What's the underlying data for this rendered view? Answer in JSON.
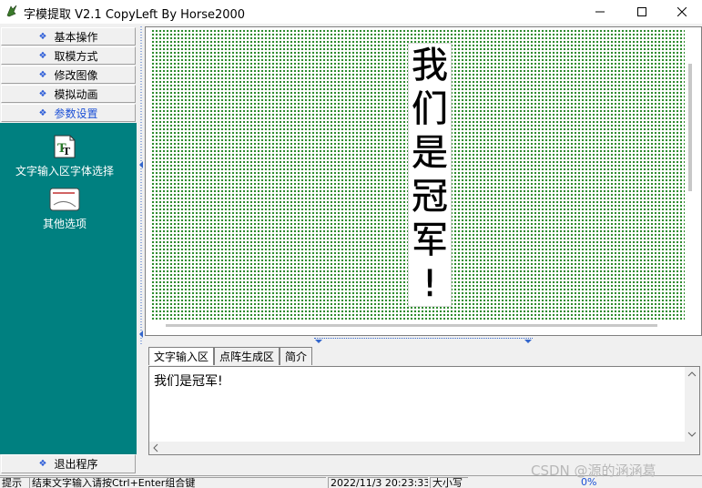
{
  "window": {
    "title": "字模提取 V2.1  CopyLeft By Horse2000",
    "minimize_glyph": "—",
    "maximize_glyph": "☐",
    "close_glyph": "✕"
  },
  "sidebar": {
    "items": [
      {
        "label": "基本操作"
      },
      {
        "label": "取模方式"
      },
      {
        "label": "修改图像"
      },
      {
        "label": "模拟动画"
      },
      {
        "label": "参数设置"
      }
    ],
    "bullet": "❖",
    "panel": [
      {
        "label": "文字输入区字体选择",
        "icon": "font-tt-icon"
      },
      {
        "label": "其他选项",
        "icon": "options-icon"
      }
    ],
    "exit_label": "退出程序"
  },
  "canvas": {
    "glyphs": [
      "我",
      "们",
      "是",
      "冠",
      "军",
      "!"
    ]
  },
  "tabs": [
    {
      "label": "文字输入区"
    },
    {
      "label": "点阵生成区"
    },
    {
      "label": "简介"
    }
  ],
  "editor": {
    "text": "我们是冠军!"
  },
  "statusbar": {
    "hint": "提示",
    "message": "结束文字输入请按Ctrl+Enter组合键",
    "datetime": "2022/11/3 20:23:33",
    "caps": "大小写",
    "progress": "0%"
  },
  "watermark": "CSDN @源的涵涵葛",
  "colors": {
    "sidebar_panel": "#008080",
    "grid_dots": "#2e8b2e",
    "accent": "#2a5bd7"
  }
}
